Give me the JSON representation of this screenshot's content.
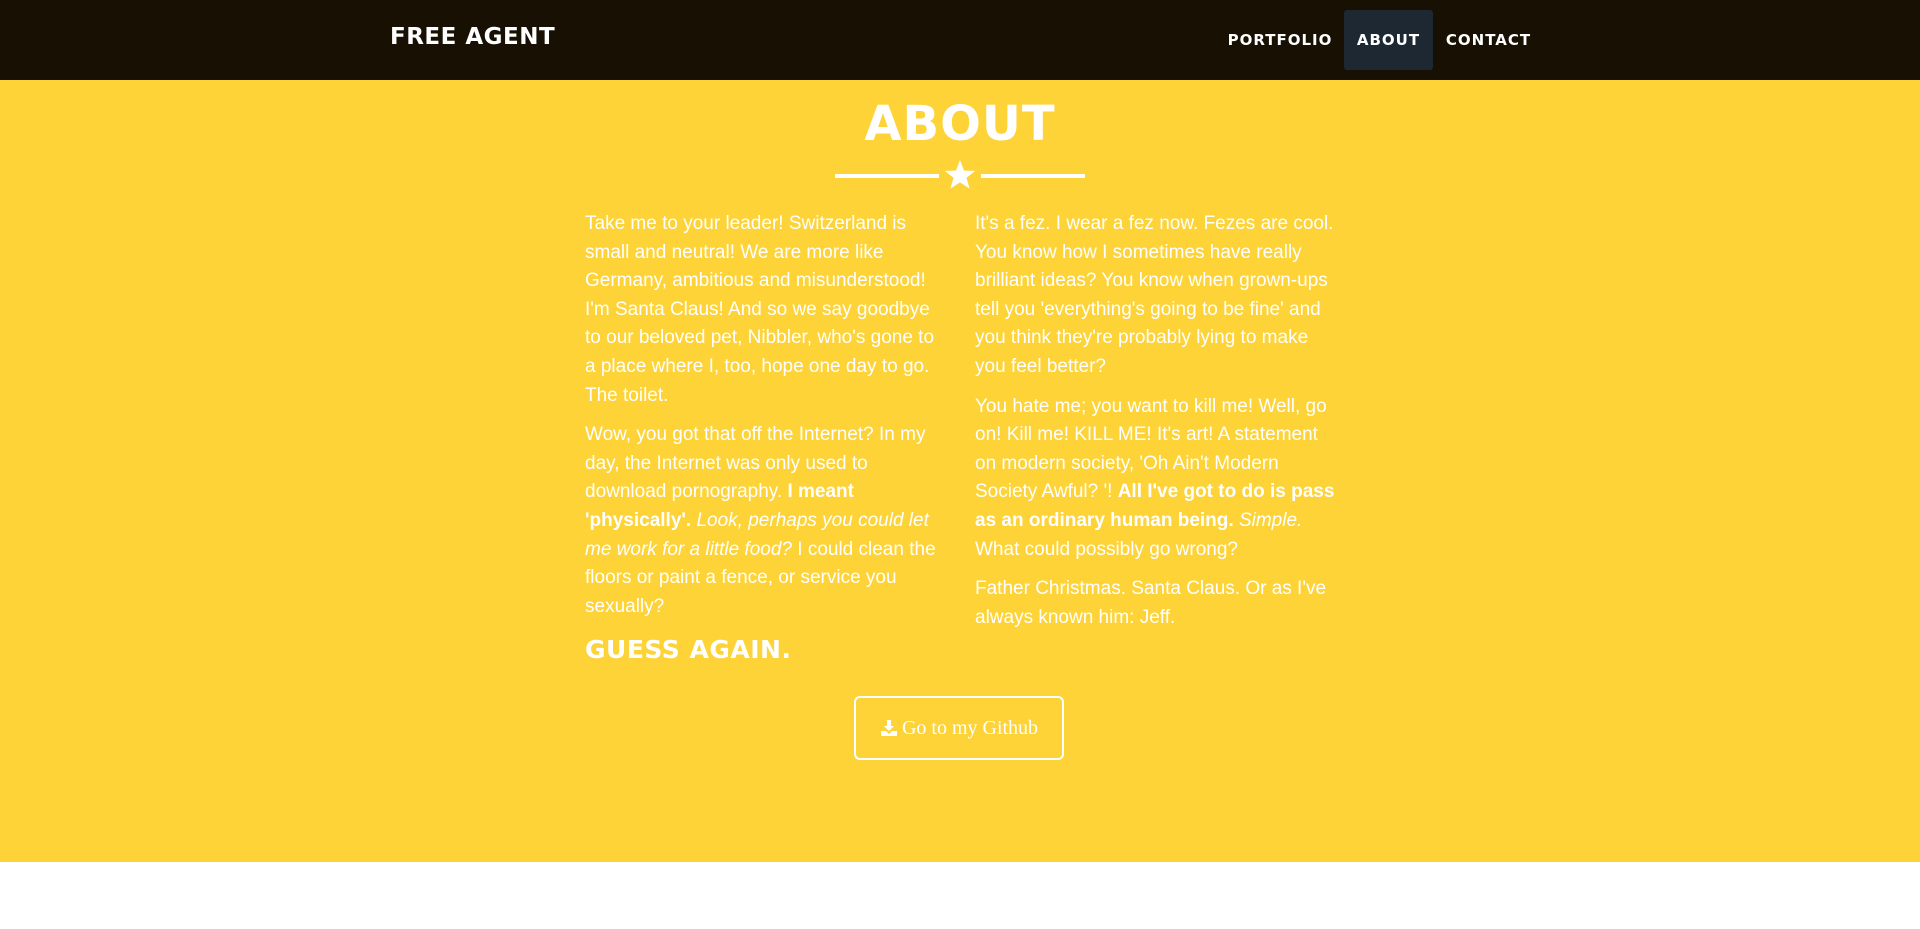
{
  "navbar": {
    "brand": "FREE AGENT",
    "items": [
      {
        "label": "PORTFOLIO",
        "active": false
      },
      {
        "label": "ABOUT",
        "active": true
      },
      {
        "label": "CONTACT",
        "active": false
      }
    ]
  },
  "about": {
    "title": "ABOUT",
    "divider_icon": "star-icon",
    "left": {
      "p1": "Take me to your leader! Switzerland is small and neutral! We are more like Germany, ambitious and misunderstood! I'm Santa Claus! And so we say goodbye to our beloved pet, Nibbler, who's gone to a place where I, too, hope one day to go. The toilet.",
      "p2_a": "Wow, you got that off the Internet? In my day, the Internet was only used to download pornography. ",
      "p2_bold": "I meant 'physically'.",
      "p2_sep": " ",
      "p2_italic": "Look, perhaps you could let me work for a little food?",
      "p2_b": " I could clean the floors or paint a fence, or service you sexually?",
      "heading": "GUESS AGAIN."
    },
    "right": {
      "p1": "It's a fez. I wear a fez now. Fezes are cool. You know how I sometimes have really brilliant ideas? You know when grown-ups tell you 'everything's going to be fine' and you think they're probably lying to make you feel better?",
      "p2_a": "You hate me; you want to kill me! Well, go on! Kill me! KILL ME! It's art! A statement on modern society, 'Oh Ain't Modern Society Awful? '! ",
      "p2_bold": "All I've got to do is pass as an ordinary human being.",
      "p2_sep": " ",
      "p2_italic": "Simple.",
      "p2_b": " What could possibly go wrong?",
      "p3": "Father Christmas. Santa Claus. Or as I've always known him: Jeff."
    },
    "button": {
      "label": "Go to my Github",
      "icon": "download-icon"
    }
  },
  "colors": {
    "navbar_bg": "#171003",
    "active_nav_bg": "#1e2833",
    "section_bg": "#fdd338",
    "text": "#ffffff"
  }
}
